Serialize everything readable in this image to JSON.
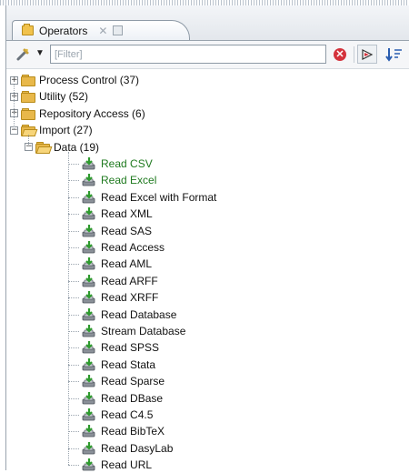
{
  "panel": {
    "tab_label": "Operators",
    "tab_close": "✕"
  },
  "toolbar": {
    "filter_placeholder": "[Filter]",
    "clear_label": "✕",
    "dropdown": "▼"
  },
  "tree": {
    "folders": [
      {
        "label": "Process Control (37)",
        "expanded": false
      },
      {
        "label": "Utility (52)",
        "expanded": false
      },
      {
        "label": "Repository Access (6)",
        "expanded": false
      },
      {
        "label": "Import (27)",
        "expanded": true
      }
    ],
    "subfolder": {
      "label": "Data (19)",
      "expanded": true
    },
    "operators": [
      {
        "label": "Read CSV",
        "color": "#1f7a1f"
      },
      {
        "label": "Read Excel",
        "color": "#1f7a1f"
      },
      {
        "label": "Read Excel with Format"
      },
      {
        "label": "Read XML"
      },
      {
        "label": "Read SAS"
      },
      {
        "label": "Read Access"
      },
      {
        "label": "Read AML"
      },
      {
        "label": "Read ARFF"
      },
      {
        "label": "Read XRFF"
      },
      {
        "label": "Read Database"
      },
      {
        "label": "Stream Database"
      },
      {
        "label": "Read SPSS"
      },
      {
        "label": "Read Stata"
      },
      {
        "label": "Read Sparse"
      },
      {
        "label": "Read DBase"
      },
      {
        "label": "Read C4.5"
      },
      {
        "label": "Read BibTeX"
      },
      {
        "label": "Read DasyLab"
      },
      {
        "label": "Read URL"
      }
    ]
  }
}
